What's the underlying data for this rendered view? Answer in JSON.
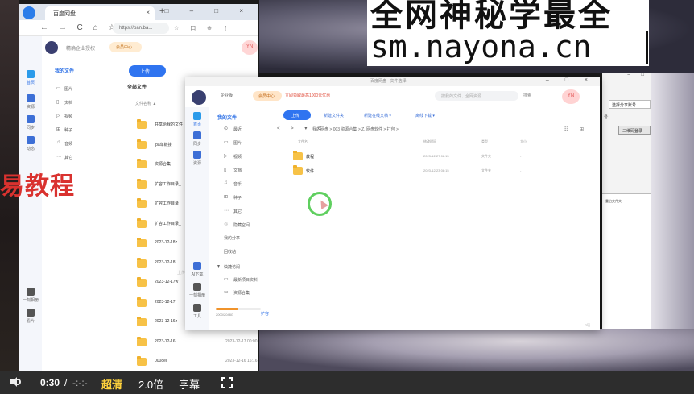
{
  "watermark": {
    "line1": "全网神秘学最全",
    "line2": "sm.nayona.cn",
    "red_text": "易教程"
  },
  "browser": {
    "tab_title": "百度网盘",
    "tab_close": "×",
    "new_tab": "+",
    "window_controls": "□ – □ ×",
    "nav_controls": "← → C ⌂ ☆",
    "url": "https://pan.ba...",
    "tools": "☆ 口 ⊕ ⋮",
    "header": {
      "brand_text": "精确企业授权",
      "vip_label": "会员中心",
      "user_initials": "YN"
    },
    "rail": [
      {
        "label": "首页",
        "active": true
      },
      {
        "label": "资源"
      },
      {
        "label": "同步"
      },
      {
        "label": "动态"
      },
      {
        "label": "一刻相册"
      },
      {
        "label": "看片"
      }
    ],
    "sidebar": {
      "head": "我的文件",
      "items": [
        {
          "icon": "▭",
          "label": "图片"
        },
        {
          "icon": "▯",
          "label": "文档"
        },
        {
          "icon": "▷",
          "label": "视频"
        },
        {
          "icon": "⊞",
          "label": "种子"
        },
        {
          "icon": "♫",
          "label": "音频"
        },
        {
          "icon": "⋯",
          "label": "其它"
        }
      ]
    },
    "main": {
      "upload_label": "上传",
      "title": "全部文件",
      "col_header": "文件名称 ▲",
      "hint": "上传文件，多端可查看",
      "rows": [
        {
          "name": "共享给我的文件",
          "date": ""
        },
        {
          "name": "ipa单链接",
          "date": ""
        },
        {
          "name": "资源合集",
          "date": ""
        },
        {
          "name": "扩容工作目录_",
          "date": ""
        },
        {
          "name": "扩容工作目录_",
          "date": ""
        },
        {
          "name": "扩容工作目录_",
          "date": ""
        },
        {
          "name": "2023-12-18z",
          "date": ""
        },
        {
          "name": "2023-12-18",
          "date": ""
        },
        {
          "name": "2023-12-17w",
          "date": ""
        },
        {
          "name": "2023-12-17",
          "date": ""
        },
        {
          "name": "2023-12-16z",
          "date": ""
        },
        {
          "name": "2023-12-16",
          "date": "2023-12-17 00:00"
        },
        {
          "name": "000del",
          "date": "2023-12-16 16:16"
        }
      ]
    }
  },
  "modal": {
    "title": "百度网盘 - 文件选择",
    "window_controls": "– □ ×",
    "header": {
      "enterprise": "企业版",
      "vip": "会员中心",
      "promo": "立即领取最高1000元优惠",
      "search_placeholder": "搜我的文件、全网资源",
      "search_button": "搜索",
      "user_initials": "YN"
    },
    "rail": [
      {
        "label": "首页",
        "active": true
      },
      {
        "label": "同步"
      },
      {
        "label": "资源"
      },
      {
        "label": "AI下载"
      },
      {
        "label": "一刻相册"
      },
      {
        "label": "工具"
      }
    ],
    "side": {
      "head": "我的文件",
      "items": [
        {
          "icon": "⊙",
          "label": "最近"
        },
        {
          "icon": "▭",
          "label": "图片"
        },
        {
          "icon": "▷",
          "label": "视频"
        },
        {
          "icon": "▯",
          "label": "文档"
        },
        {
          "icon": "♫",
          "label": "音乐"
        },
        {
          "icon": "⊞",
          "label": "种子"
        },
        {
          "icon": "⋯",
          "label": "其它"
        },
        {
          "icon": "♲",
          "label": "隐藏空间"
        },
        {
          "icon": "",
          "label": "我的分享"
        },
        {
          "icon": "",
          "label": "回收站"
        },
        {
          "icon": "▾",
          "label": "快捷访问"
        },
        {
          "icon": "▭",
          "label": "最新项目资料"
        },
        {
          "icon": "▭",
          "label": "资源合集"
        }
      ],
      "quota": "2000/2048G",
      "quota_fraction": 0.5,
      "expand": "扩容"
    },
    "main": {
      "upload": "上传",
      "actions": [
        "新建文件夹",
        "新建在线文档 ▾",
        "离线下载 ▾"
      ],
      "nav_controls": "< > ▾ C",
      "breadcrumb": "我的网盘 > 003 资源合集 > Z.  网盘软件 > 打包 >",
      "view_icons": "☷ ⊞",
      "columns": [
        "文件名",
        "修改时间",
        "类型",
        "大小"
      ],
      "rows": [
        {
          "name": "教程",
          "time": "2023-12-27 08:15",
          "type": "文件夹",
          "size": "-"
        },
        {
          "name": "软件",
          "time": "2023-12-23 08:15",
          "type": "文件夹",
          "size": "-"
        }
      ],
      "footer": "2项"
    }
  },
  "right_window": {
    "select_value": "选择分享账号",
    "button_label": "二维码登录",
    "panel_text": "重启文件夹",
    "window_controls": "– □",
    "colon": "号："
  },
  "video": {
    "current_time": "0:30",
    "separator": "/",
    "duration": "-:-:-",
    "quality": "超清",
    "speed": "2.0倍",
    "subtitle": "字幕",
    "colors": {
      "quality": "#ffd23c",
      "bar": "#2d2d2d"
    }
  }
}
